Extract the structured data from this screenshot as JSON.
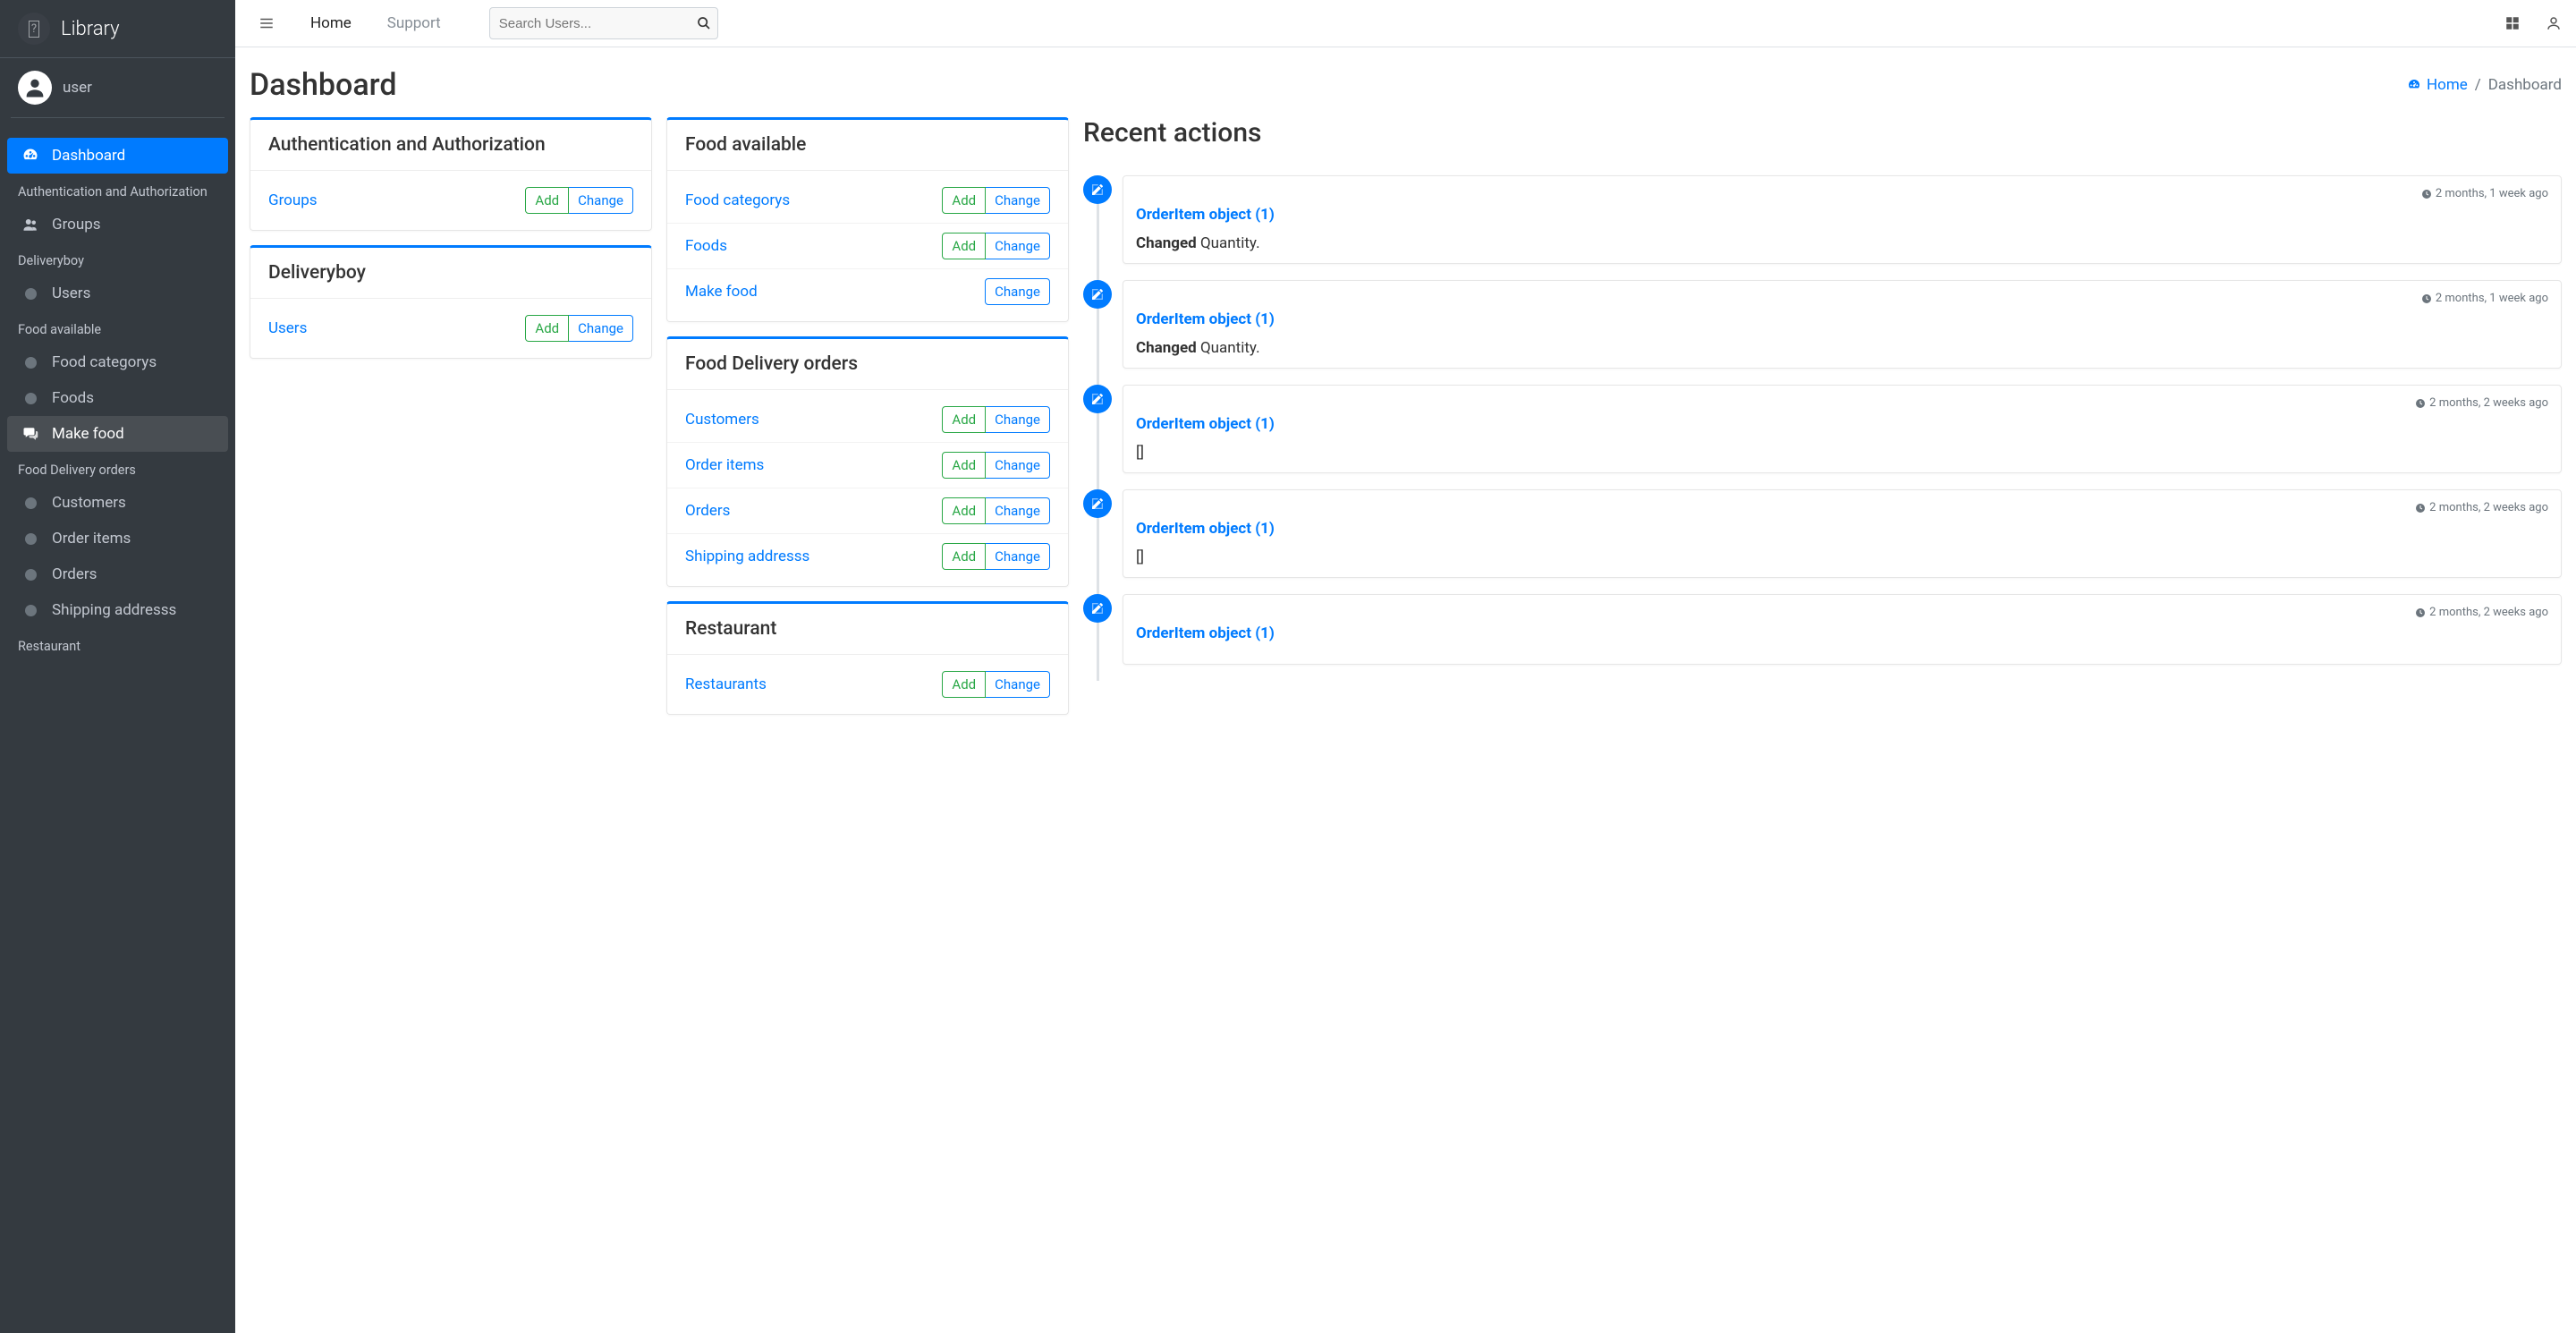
{
  "brand": {
    "text": "Library"
  },
  "user": {
    "name": "user"
  },
  "sidebar": {
    "dashboard": "Dashboard",
    "groups": [
      {
        "header": "Authentication and Authorization",
        "items": [
          {
            "label": "Groups",
            "icon": "users"
          }
        ]
      },
      {
        "header": "Deliveryboy",
        "items": [
          {
            "label": "Users",
            "icon": "bullet"
          }
        ]
      },
      {
        "header": "Food available",
        "items": [
          {
            "label": "Food categorys",
            "icon": "bullet"
          },
          {
            "label": "Foods",
            "icon": "bullet"
          },
          {
            "label": "Make food",
            "icon": "comments",
            "selected": true
          }
        ]
      },
      {
        "header": "Food Delivery orders",
        "items": [
          {
            "label": "Customers",
            "icon": "bullet"
          },
          {
            "label": "Order items",
            "icon": "bullet"
          },
          {
            "label": "Orders",
            "icon": "bullet"
          },
          {
            "label": "Shipping addresss",
            "icon": "bullet"
          }
        ]
      },
      {
        "header": "Restaurant",
        "items": []
      }
    ]
  },
  "topbar": {
    "home": "Home",
    "support": "Support",
    "search_placeholder": "Search Users..."
  },
  "page": {
    "title": "Dashboard",
    "breadcrumb_home": "Home",
    "breadcrumb_current": "Dashboard"
  },
  "labels": {
    "add": "Add",
    "change": "Change"
  },
  "apps_left": [
    {
      "title": "Authentication and Authorization",
      "models": [
        {
          "name": "Groups",
          "add": true,
          "change": true
        }
      ]
    },
    {
      "title": "Deliveryboy",
      "models": [
        {
          "name": "Users",
          "add": true,
          "change": true
        }
      ]
    }
  ],
  "apps_mid": [
    {
      "title": "Food available",
      "models": [
        {
          "name": "Food categorys",
          "add": true,
          "change": true
        },
        {
          "name": "Foods",
          "add": true,
          "change": true
        },
        {
          "name": "Make food",
          "add": false,
          "change": true
        }
      ]
    },
    {
      "title": "Food Delivery orders",
      "models": [
        {
          "name": "Customers",
          "add": true,
          "change": true
        },
        {
          "name": "Order items",
          "add": true,
          "change": true
        },
        {
          "name": "Orders",
          "add": true,
          "change": true
        },
        {
          "name": "Shipping addresss",
          "add": true,
          "change": true
        }
      ]
    },
    {
      "title": "Restaurant",
      "models": [
        {
          "name": "Restaurants",
          "add": true,
          "change": true
        }
      ]
    }
  ],
  "recent": {
    "title": "Recent actions",
    "items": [
      {
        "time": "2 months, 1 week ago",
        "object": "OrderItem object (1)",
        "action_label": "Changed",
        "action_text": " Quantity."
      },
      {
        "time": "2 months, 1 week ago",
        "object": "OrderItem object (1)",
        "action_label": "Changed",
        "action_text": " Quantity."
      },
      {
        "time": "2 months, 2 weeks ago",
        "object": "OrderItem object (1)",
        "action_label": "",
        "action_text": "[]"
      },
      {
        "time": "2 months, 2 weeks ago",
        "object": "OrderItem object (1)",
        "action_label": "",
        "action_text": "[]"
      },
      {
        "time": "2 months, 2 weeks ago",
        "object": "OrderItem object (1)",
        "action_label": "",
        "action_text": ""
      }
    ]
  }
}
